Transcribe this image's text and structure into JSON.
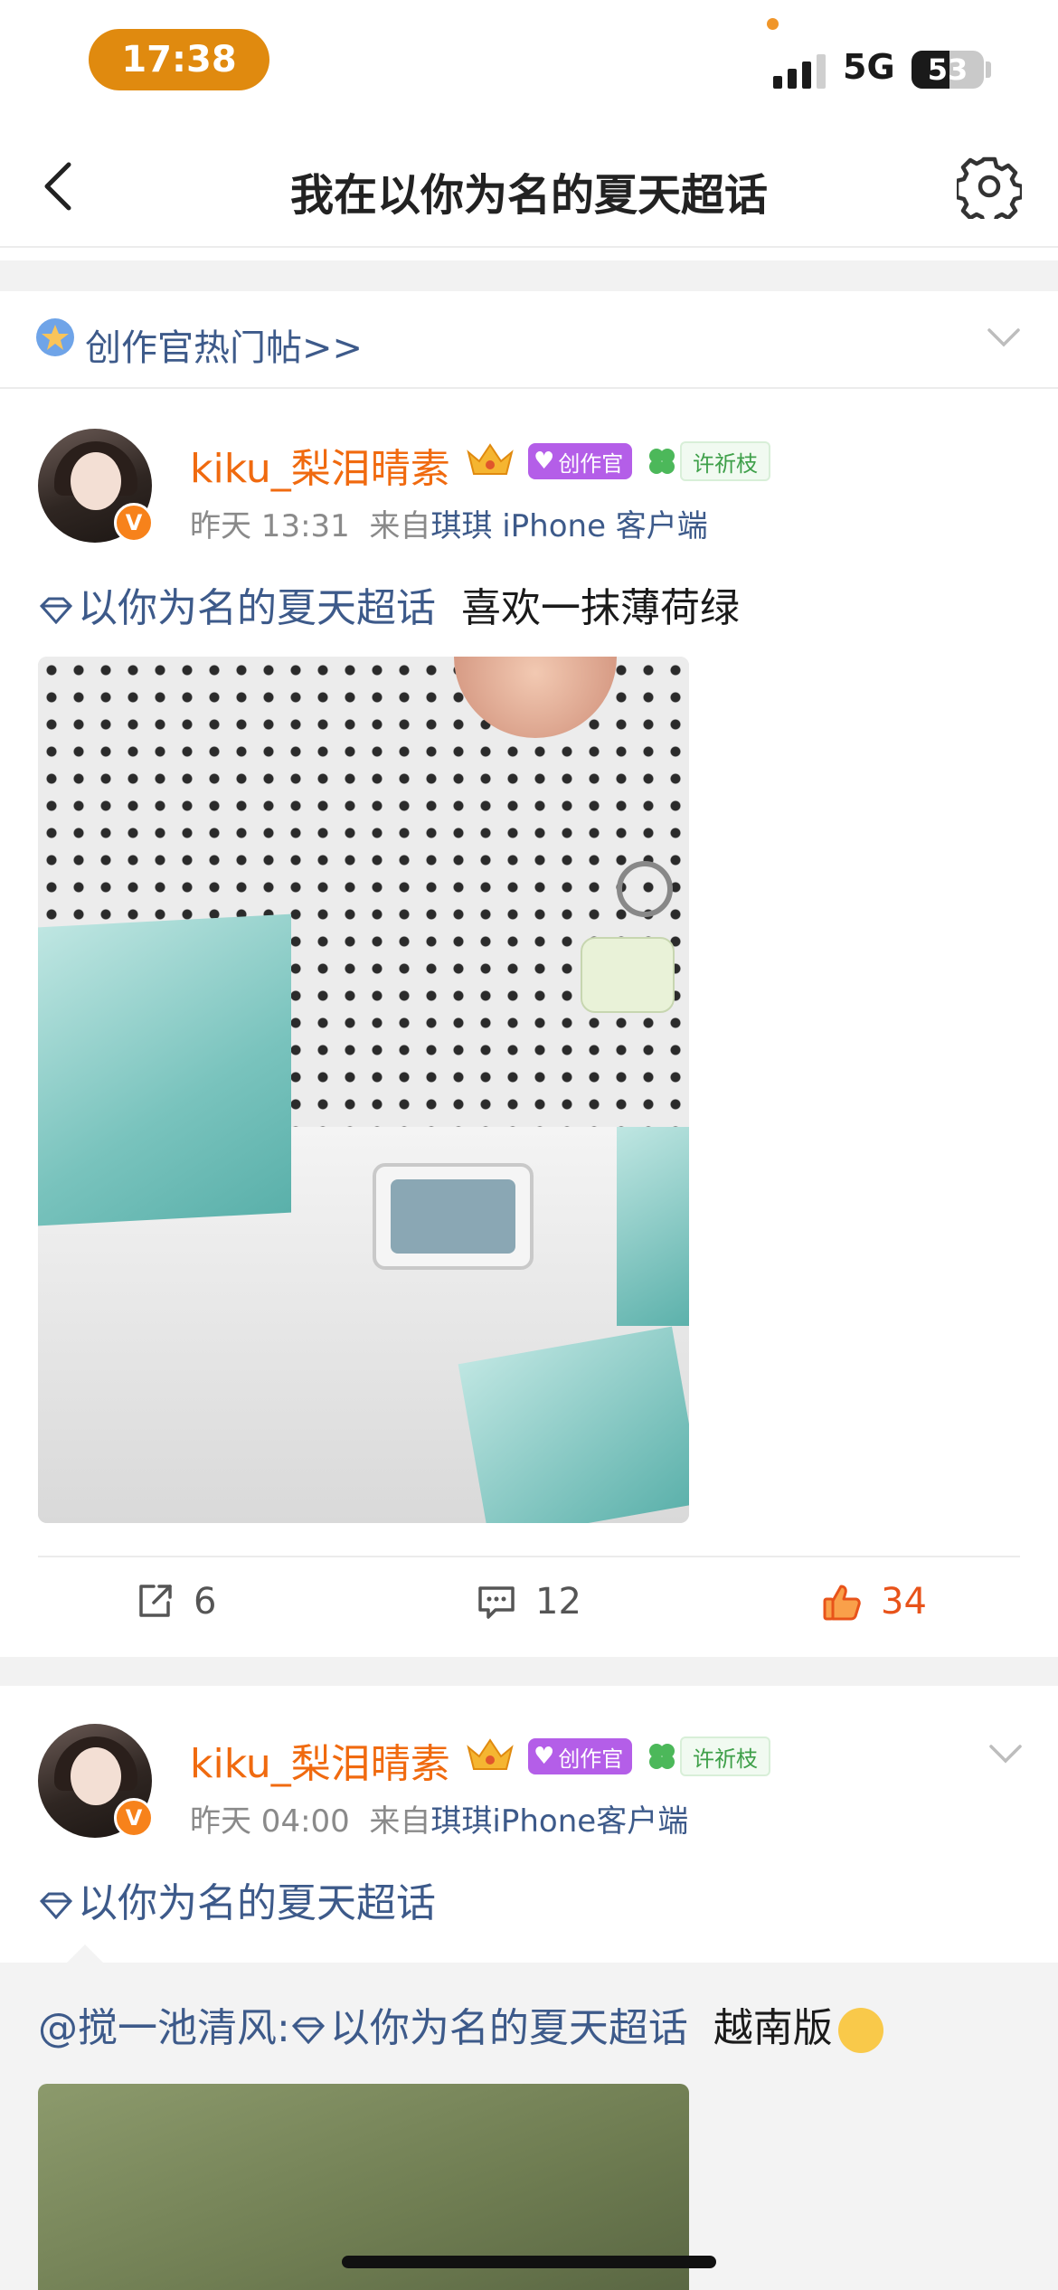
{
  "status_bar": {
    "time": "17:38",
    "network": "5G",
    "battery": "53",
    "battery_level": 0.53
  },
  "nav": {
    "title": "我在以你为名的夏天超话",
    "back_icon": "chevron-left-icon",
    "settings_icon": "gear-icon"
  },
  "hot_posts": {
    "label": "创作官热门帖>>",
    "icon": "badge-icon",
    "expand_icon": "chevron-down-icon"
  },
  "posts": [
    {
      "username": "kiku_梨泪晴素",
      "badges": {
        "creator": "创作官",
        "wish": "许祈枝"
      },
      "verified": "V",
      "time": "昨天 13:31",
      "source_prefix": "来自",
      "source": "琪琪 iPhone 客户端",
      "topic": "以你为名的夏天超话",
      "text": "喜欢一抹薄荷绿",
      "actions": {
        "repost_count": "6",
        "comment_count": "12",
        "like_count": "34"
      }
    },
    {
      "username": "kiku_梨泪晴素",
      "badges": {
        "creator": "创作官",
        "wish": "许祈枝"
      },
      "verified": "V",
      "time": "昨天 04:00",
      "source_prefix": "来自",
      "source": "琪琪iPhone客户端",
      "topic": "以你为名的夏天超话",
      "repost": {
        "mention": "@搅一池清风:",
        "topic": "以你为名的夏天超话",
        "text": "越南版"
      }
    }
  ],
  "colors": {
    "accent_orange": "#f06a0f",
    "link_blue": "#3d5a8a",
    "like_red": "#e8531a",
    "time_pill": "#e08a0f"
  }
}
